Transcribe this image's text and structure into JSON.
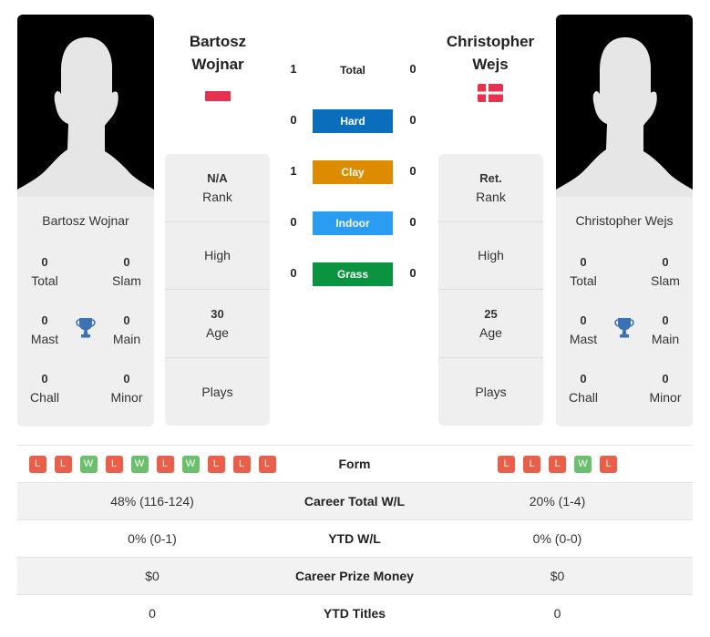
{
  "player1": {
    "name_line1": "Bartosz",
    "name_line2": "Wojnar",
    "full_name": "Bartosz Wojnar",
    "flag": "poland",
    "stats": {
      "total": {
        "value": "0",
        "label": "Total"
      },
      "slam": {
        "value": "0",
        "label": "Slam"
      },
      "mast": {
        "value": "0",
        "label": "Mast"
      },
      "main": {
        "value": "0",
        "label": "Main"
      },
      "chall": {
        "value": "0",
        "label": "Chall"
      },
      "minor": {
        "value": "0",
        "label": "Minor"
      }
    },
    "info": {
      "rank_value": "N/A",
      "rank_label": "Rank",
      "high_label": "High",
      "age_value": "30",
      "age_label": "Age",
      "plays_label": "Plays"
    }
  },
  "player2": {
    "name_line1": "Christopher",
    "name_line2": "Wejs",
    "full_name": "Christopher Wejs",
    "flag": "denmark",
    "stats": {
      "total": {
        "value": "0",
        "label": "Total"
      },
      "slam": {
        "value": "0",
        "label": "Slam"
      },
      "mast": {
        "value": "0",
        "label": "Mast"
      },
      "main": {
        "value": "0",
        "label": "Main"
      },
      "chall": {
        "value": "0",
        "label": "Chall"
      },
      "minor": {
        "value": "0",
        "label": "Minor"
      }
    },
    "info": {
      "rank_value": "Ret.",
      "rank_label": "Rank",
      "high_label": "High",
      "age_value": "25",
      "age_label": "Age",
      "plays_label": "Plays"
    }
  },
  "h2h": {
    "total": {
      "label": "Total",
      "p1": "1",
      "p2": "0"
    },
    "surfaces": [
      {
        "label": "Hard",
        "p1": "0",
        "p2": "0",
        "color": "#0a6ebd"
      },
      {
        "label": "Clay",
        "p1": "1",
        "p2": "0",
        "color": "#dd8c00"
      },
      {
        "label": "Indoor",
        "p1": "0",
        "p2": "0",
        "color": "#2a9cf2"
      },
      {
        "label": "Grass",
        "p1": "0",
        "p2": "0",
        "color": "#0a9440"
      }
    ]
  },
  "table": {
    "form_label": "Form",
    "p1_form": [
      "L",
      "L",
      "W",
      "L",
      "W",
      "L",
      "W",
      "L",
      "L",
      "L"
    ],
    "p2_form": [
      "L",
      "L",
      "L",
      "W",
      "L"
    ],
    "rows": [
      {
        "label": "Career Total W/L",
        "p1": "48% (116-124)",
        "p2": "20% (1-4)"
      },
      {
        "label": "YTD W/L",
        "p1": "0% (0-1)",
        "p2": "0% (0-0)"
      },
      {
        "label": "Career Prize Money",
        "p1": "$0",
        "p2": "$0"
      },
      {
        "label": "YTD Titles",
        "p1": "0",
        "p2": "0"
      }
    ]
  },
  "icons": {
    "trophy": "trophy-icon",
    "silhouette": "player-silhouette"
  }
}
